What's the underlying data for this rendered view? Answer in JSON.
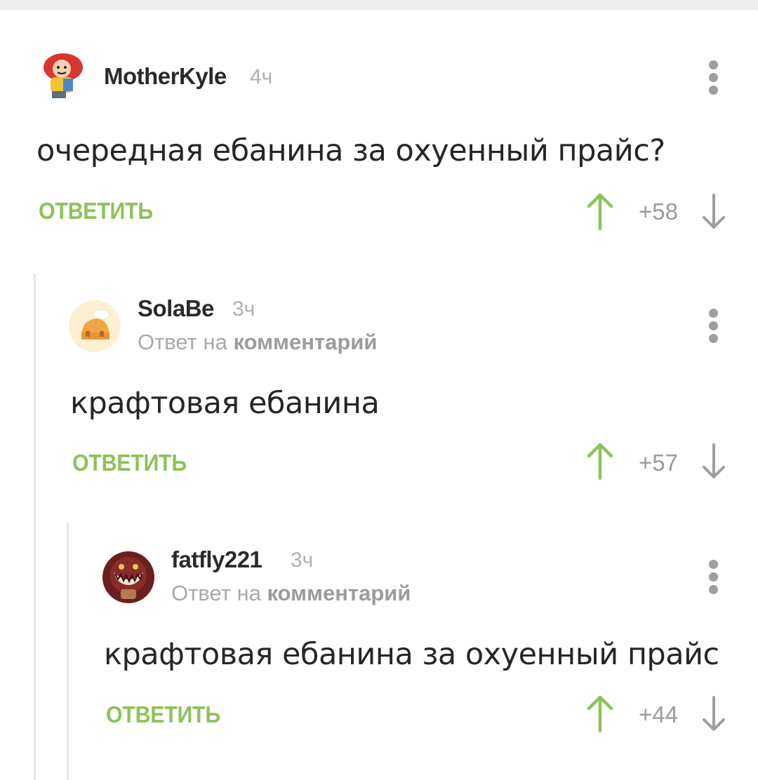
{
  "comments": [
    {
      "username": "MotherKyle",
      "time": "4ч",
      "text": "очередная ебанина за охуенный прайс?",
      "reply_label": "ОТВЕТИТЬ",
      "rating": "+58",
      "avatar_icon": "girl-avatar-icon"
    },
    {
      "username": "SolaBe",
      "time": "3ч",
      "reply_prefix": "Ответ на",
      "reply_target": "комментарий",
      "text": "крафтовая ебанина",
      "reply_label": "ОТВЕТИТЬ",
      "rating": "+57",
      "avatar_icon": "house-avatar-icon"
    },
    {
      "username": "fatfly221",
      "time": "3ч",
      "reply_prefix": "Ответ на",
      "reply_target": "комментарий",
      "text": "крафтовая ебанина за охуенный прайс",
      "reply_label": "ОТВЕТИТЬ",
      "rating": "+44",
      "avatar_icon": "monster-avatar-icon"
    }
  ],
  "colors": {
    "accent_green": "#8dc25a",
    "vote_up": "#8dc25a",
    "vote_down": "#9e9e9e",
    "muted_text": "#a9a9a9"
  }
}
